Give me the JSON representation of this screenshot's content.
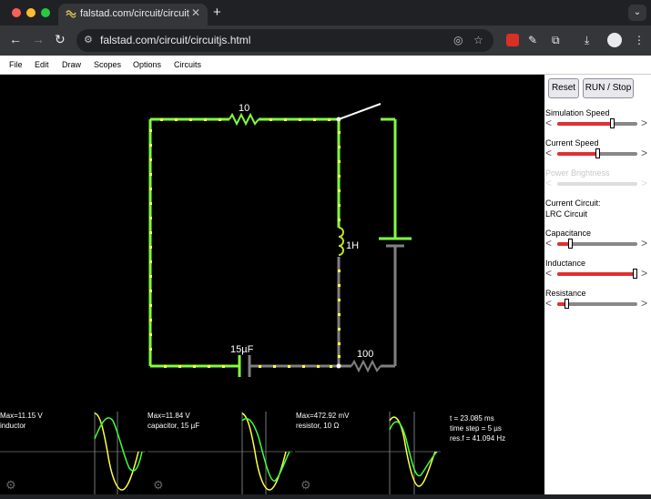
{
  "browser": {
    "tab_title": "falstad.com/circuit/circuitjs.html",
    "url": "falstad.com/circuit/circuitjs.html",
    "new_tab_icon": "plus-icon",
    "tab_menu_icon": "chevron-down-icon"
  },
  "menubar": {
    "items": [
      "File",
      "Edit",
      "Draw",
      "Scopes",
      "Options",
      "Circuits"
    ]
  },
  "circuit": {
    "resistor_top_label": "10",
    "inductor_label": "1H",
    "capacitor_label": "15µF",
    "resistor_bottom_label": "100"
  },
  "scopes": [
    {
      "max": "Max=11.15 V",
      "name": "inductor"
    },
    {
      "max": "Max=11.84 V",
      "name": "capacitor, 15 µF"
    },
    {
      "max": "Max=472.92 mV",
      "name": "resistor, 10 Ω"
    }
  ],
  "sim_info": {
    "time": "t = 23.085 ms",
    "time_step": "time step = 5 µs",
    "res_f": "res.f = 41.094 Hz"
  },
  "panel": {
    "reset_label": "Reset",
    "run_label": "RUN / Stop",
    "sim_speed_label": "Simulation Speed",
    "current_speed_label": "Current Speed",
    "power_brightness_label": "Power Brightness",
    "current_circuit_label": "Current Circuit:",
    "current_circuit_name": "LRC Circuit",
    "capacitance_label": "Capacitance",
    "inductance_label": "Inductance",
    "resistance_label": "Resistance",
    "sliders": {
      "simulation_speed": 0.7,
      "current_speed": 0.5,
      "power_brightness": 0.5,
      "capacitance": 0.15,
      "inductance": 1.0,
      "resistance": 0.1
    }
  },
  "colors": {
    "wire_high": "#7fff3f",
    "wire_low": "#808080",
    "current_dot": "#ffff40",
    "slider_fill": "#e03030",
    "scope_voltage": "#40ff40",
    "scope_current": "#ffff40"
  }
}
